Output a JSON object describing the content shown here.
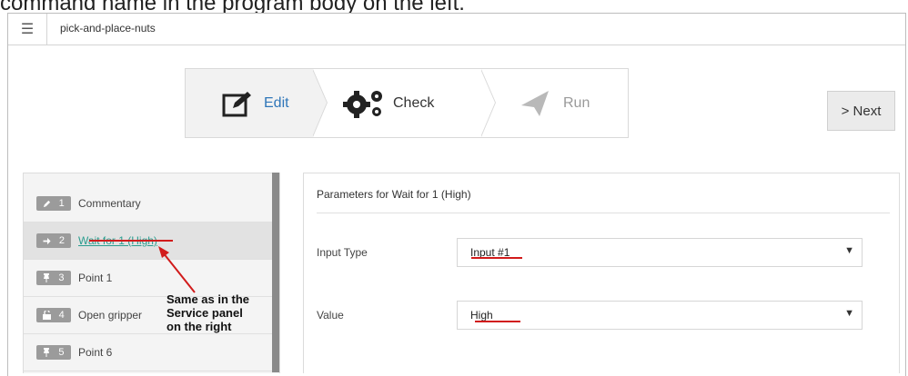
{
  "caption": "command name in the program body on the left.",
  "topbar": {
    "menu_icon": "hamburger-icon",
    "program_name": "pick-and-place-nuts"
  },
  "stepper": {
    "steps": [
      {
        "label": "Edit",
        "icon": "pencil-square-icon",
        "state": "active"
      },
      {
        "label": "Check",
        "icon": "gears-icon",
        "state": "normal"
      },
      {
        "label": "Run",
        "icon": "paper-plane-icon",
        "state": "disabled"
      }
    ]
  },
  "next_button": {
    "label": "> Next"
  },
  "commands": [
    {
      "number": "1",
      "icon": "pencil-icon",
      "label": "Commentary",
      "selected": false
    },
    {
      "number": "2",
      "icon": "sign-in-icon",
      "label": "Wait for 1 (High)",
      "selected": true
    },
    {
      "number": "3",
      "icon": "pin-icon",
      "label": "Point 1",
      "selected": false
    },
    {
      "number": "4",
      "icon": "unlock-icon",
      "label": "Open gripper",
      "selected": false
    },
    {
      "number": "5",
      "icon": "pin-icon",
      "label": "Point 6",
      "selected": false
    }
  ],
  "params": {
    "title": "Parameters for  Wait for 1 (High)",
    "input_type_label": "Input Type",
    "input_type_value": "Input #1",
    "value_label": "Value",
    "value_value": "High"
  },
  "annotation": {
    "text": "Same as in the\nService panel\non the right"
  },
  "colors": {
    "accent": "#2f76b9",
    "link": "#2a9d8f",
    "annotation": "#d11b1b",
    "badge": "#9b9b9b"
  }
}
